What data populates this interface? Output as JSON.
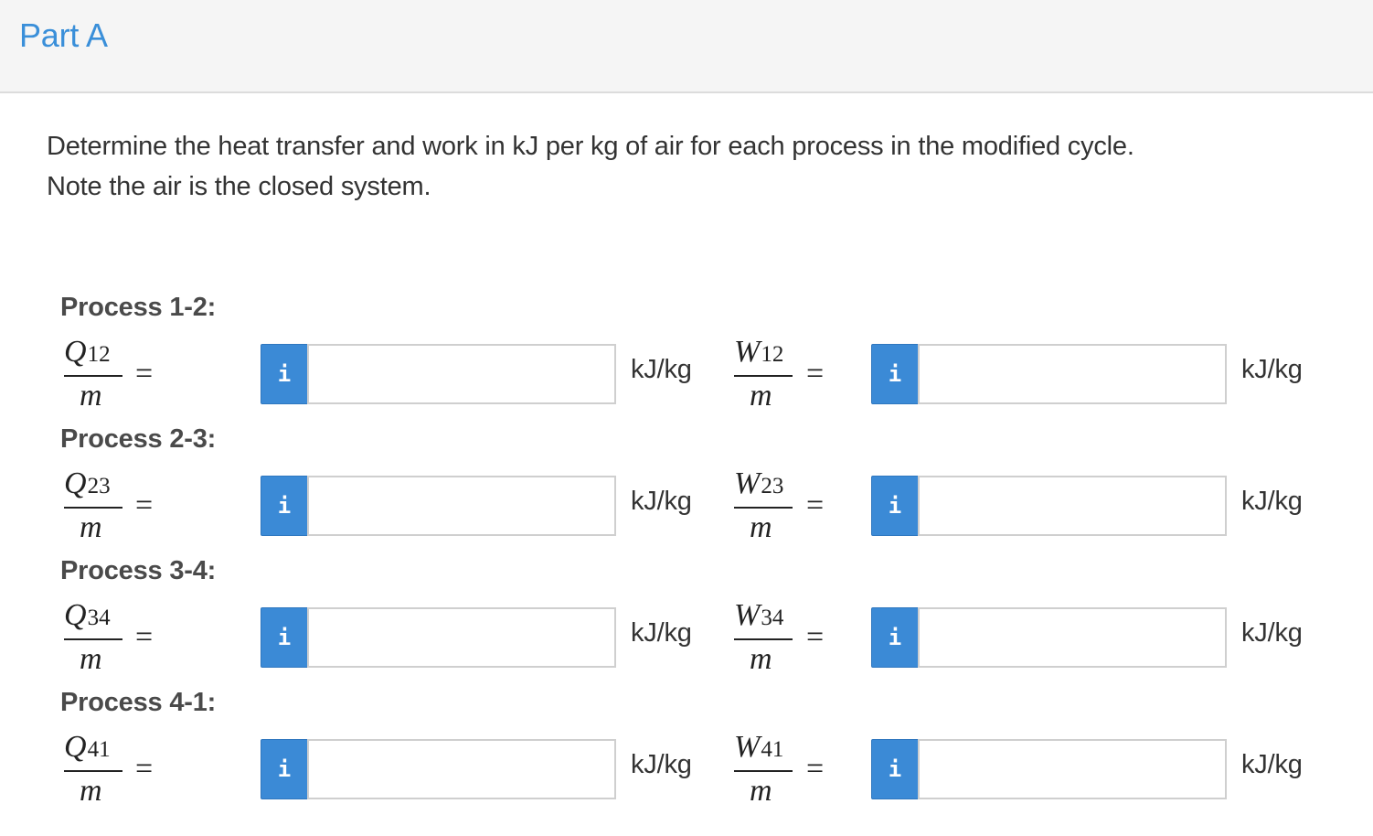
{
  "header": {
    "title": "Part A"
  },
  "prompt": {
    "line1": "Determine the heat transfer and work in kJ per kg of air for each process in the modified cycle.",
    "line2": "Note the air is the closed system."
  },
  "icons": {
    "info": "info-icon"
  },
  "colors": {
    "accent": "#3a8fd9",
    "info_button": "#3b8ad6",
    "header_bg": "#f5f5f5"
  },
  "processes": [
    {
      "heading": "Process 1-2:",
      "q_symbol": "Q",
      "q_sub": "12",
      "q_den": "m",
      "w_symbol": "W",
      "w_sub": "12",
      "w_den": "m",
      "eq": "=",
      "info_glyph": "i",
      "q_value": "",
      "w_value": "",
      "q_unit": "kJ/kg",
      "w_unit": "kJ/kg"
    },
    {
      "heading": "Process 2-3:",
      "q_symbol": "Q",
      "q_sub": "23",
      "q_den": "m",
      "w_symbol": "W",
      "w_sub": "23",
      "w_den": "m",
      "eq": "=",
      "info_glyph": "i",
      "q_value": "",
      "w_value": "",
      "q_unit": "kJ/kg",
      "w_unit": "kJ/kg"
    },
    {
      "heading": "Process 3-4:",
      "q_symbol": "Q",
      "q_sub": "34",
      "q_den": "m",
      "w_symbol": "W",
      "w_sub": "34",
      "w_den": "m",
      "eq": "=",
      "info_glyph": "i",
      "q_value": "",
      "w_value": "",
      "q_unit": "kJ/kg",
      "w_unit": "kJ/kg"
    },
    {
      "heading": "Process 4-1:",
      "q_symbol": "Q",
      "q_sub": "41",
      "q_den": "m",
      "w_symbol": "W",
      "w_sub": "41",
      "w_den": "m",
      "eq": "=",
      "info_glyph": "i",
      "q_value": "",
      "w_value": "",
      "q_unit": "kJ/kg",
      "w_unit": "kJ/kg"
    }
  ]
}
